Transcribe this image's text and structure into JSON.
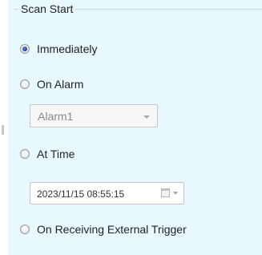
{
  "group": {
    "title": "Scan Start"
  },
  "options": {
    "immediately": {
      "label": "Immediately",
      "checked": true
    },
    "on_alarm": {
      "label": "On Alarm",
      "checked": false
    },
    "at_time": {
      "label": "At Time",
      "checked": false
    },
    "on_external_trigger": {
      "label": "On Receiving External Trigger",
      "checked": false
    }
  },
  "alarm_select": {
    "value": "Alarm1"
  },
  "time_picker": {
    "value": "2023/11/15 08:55:15"
  },
  "colors": {
    "panel_bg": "#e8f8ff",
    "radio_selected": "#1b3f9a",
    "disabled_text": "#8a8a8a"
  },
  "icons": {
    "radio": "radio-button",
    "dropdown": "chevron-down-icon",
    "calendar": "calendar-icon"
  }
}
